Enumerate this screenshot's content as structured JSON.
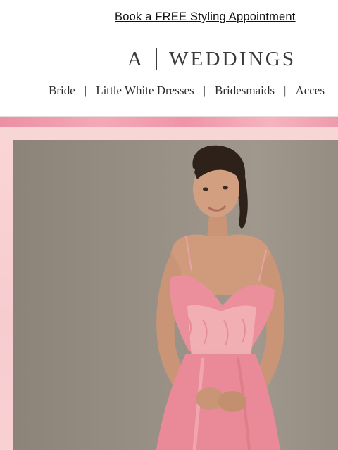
{
  "promo": {
    "text": "Book a FREE Styling Appointment"
  },
  "logo": {
    "mark": "A",
    "wordmark": "WEDDINGS"
  },
  "nav": {
    "items": [
      {
        "label": "Bride"
      },
      {
        "label": "Little White Dresses"
      },
      {
        "label": "Bridesmaids"
      },
      {
        "label": "Acces"
      }
    ],
    "separator": "|"
  },
  "colors": {
    "banner_pink": "#f7cfcf",
    "stripe_pink": "#ef94a9",
    "dress_pink": "#ec8f9c",
    "photo_backdrop": "#978f84"
  }
}
